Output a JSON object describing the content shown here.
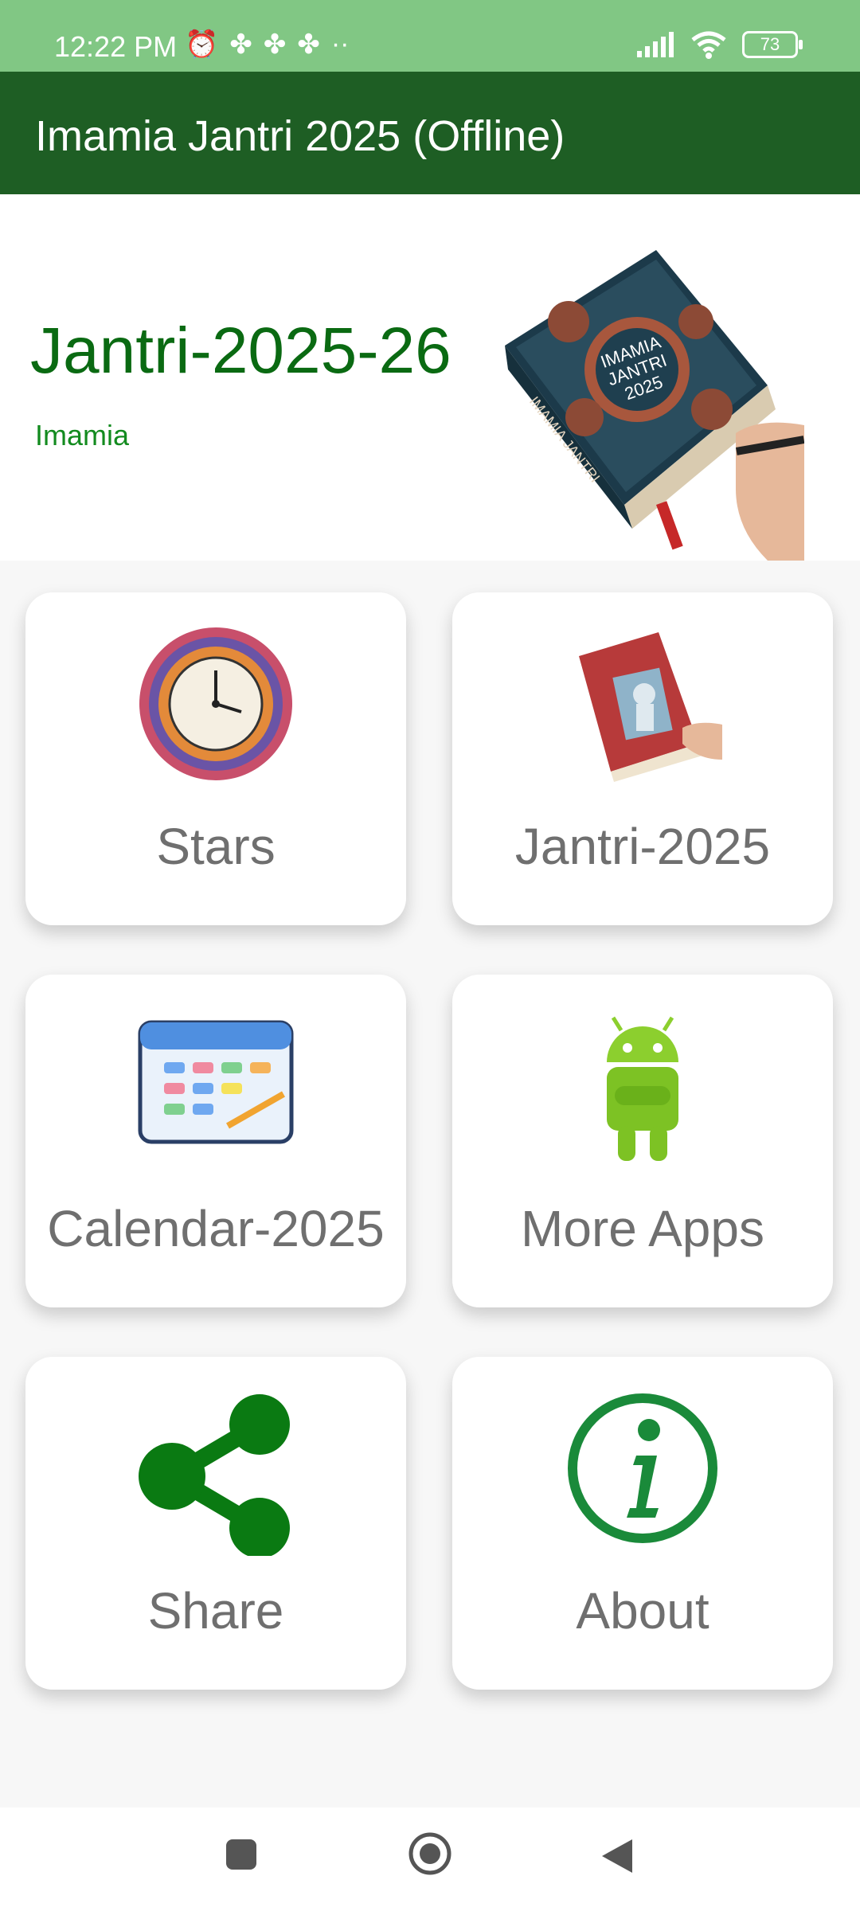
{
  "status_bar": {
    "time": "12:22 PM",
    "battery": "73",
    "icons": [
      "alarm-icon",
      "fan-icon",
      "fan-icon",
      "fan-icon",
      "more-dots-icon",
      "signal-icon",
      "wifi-icon",
      "battery-icon"
    ]
  },
  "app_bar": {
    "title": "Imamia Jantri 2025 (Offline)"
  },
  "header": {
    "title": "Jantri-2025-26",
    "subtitle": "Imamia",
    "book_text": "IMAMIA JANTRI 2025",
    "book_spine": "IMAMIA JANTRI"
  },
  "cards": [
    {
      "label": "Stars"
    },
    {
      "label": "Jantri-2025"
    },
    {
      "label": "Calendar-2025"
    },
    {
      "label": "More Apps"
    },
    {
      "label": "Share"
    },
    {
      "label": "About"
    }
  ],
  "colors": {
    "status_bar": "#81c784",
    "app_bar": "#1e5e24",
    "accent": "#0a7a12"
  }
}
